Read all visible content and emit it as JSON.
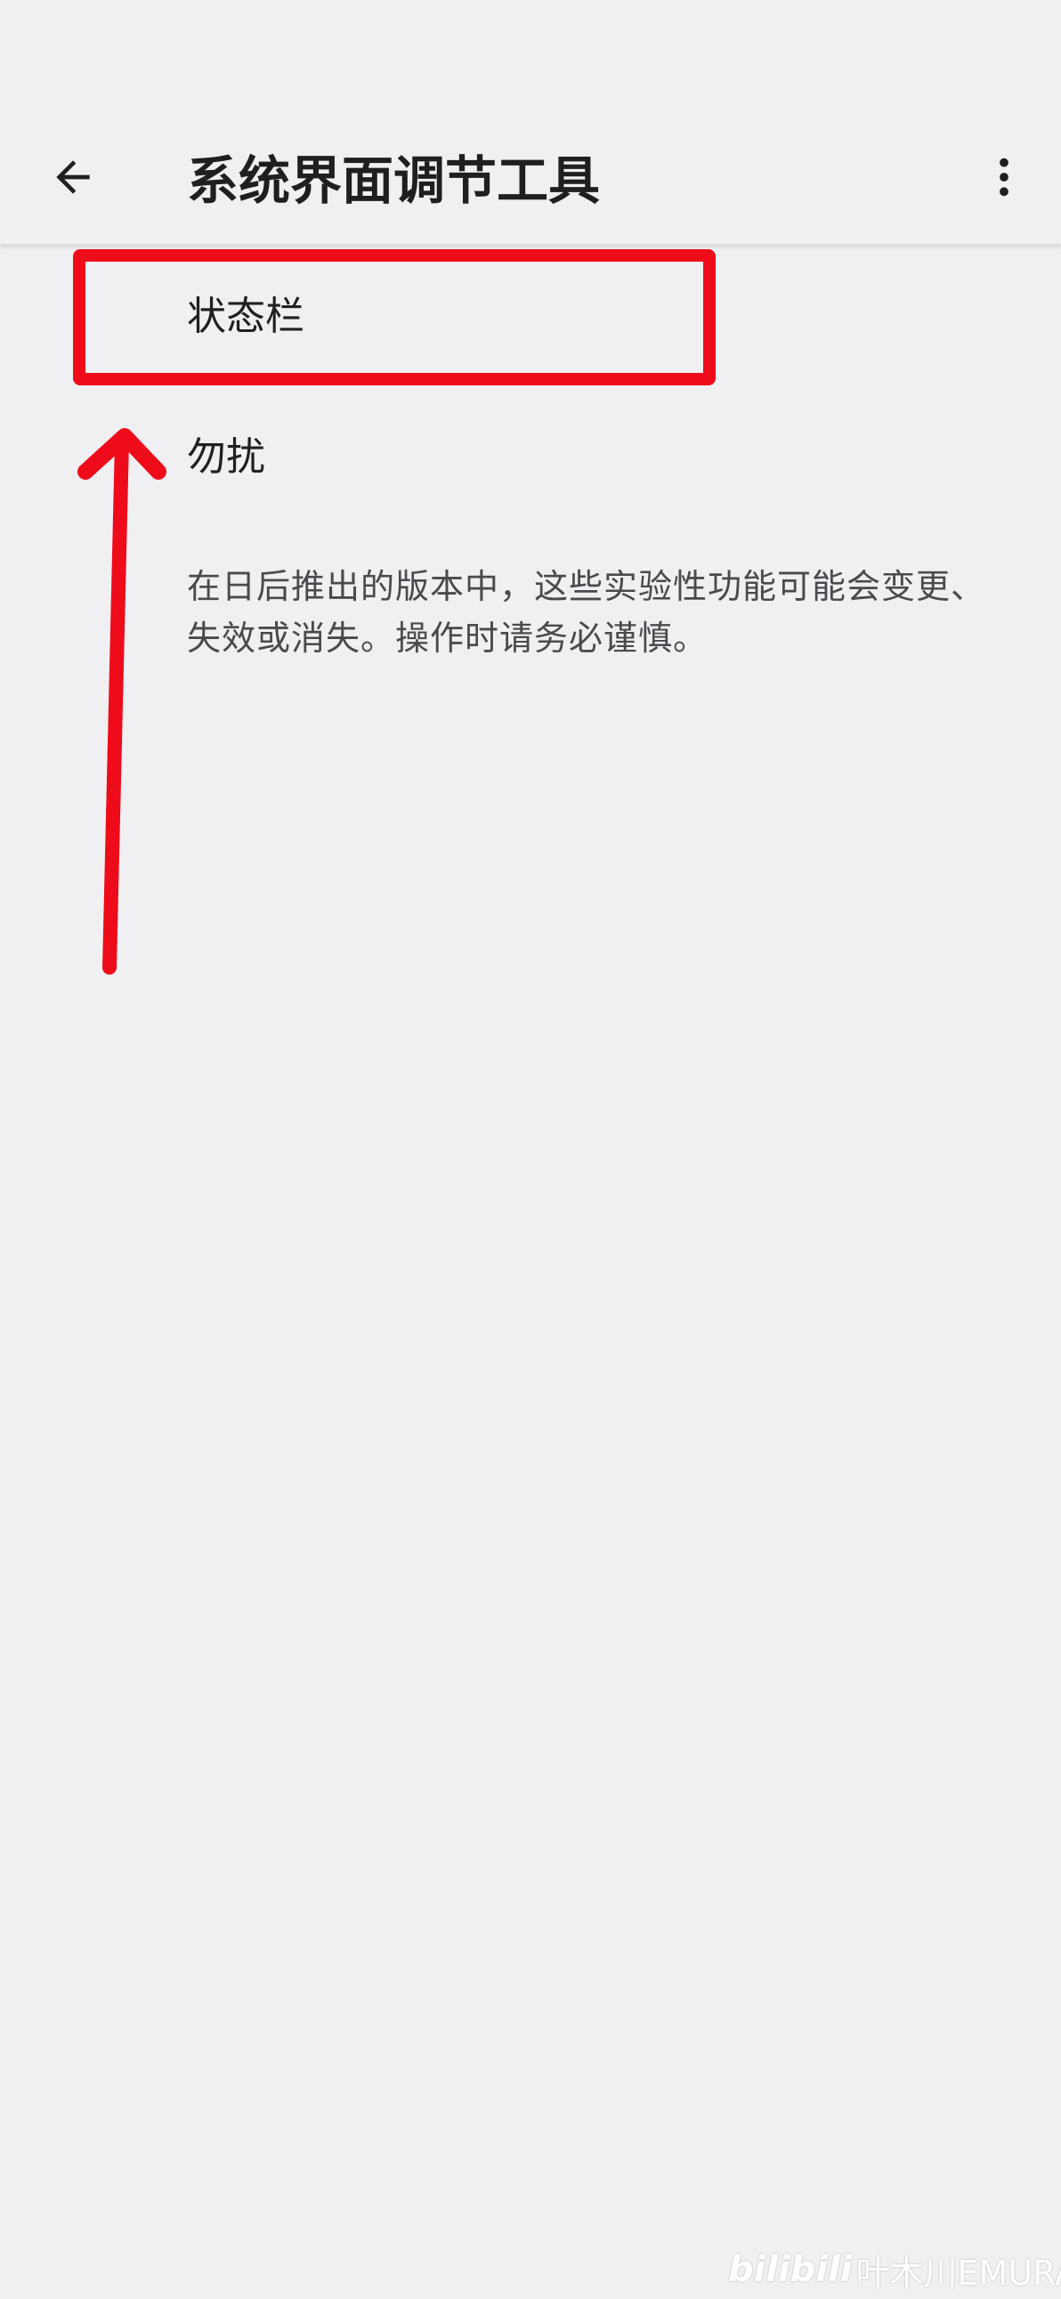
{
  "header": {
    "title": "系统界面调节工具",
    "back_icon": "arrow-left-icon",
    "menu_icon": "more-vert-icon"
  },
  "items": [
    {
      "label": "状态栏"
    },
    {
      "label": "勿扰"
    }
  ],
  "footer_note": "在日后推出的版本中，这些实验性功能可能会变更、失效或消失。操作时请务必谨慎。",
  "annotation": {
    "color": "#ee0b1a"
  },
  "watermark": {
    "logo": "bilibili",
    "author": "叶木川EMURAIN"
  },
  "colors": {
    "background": "#f0f0f3",
    "text_primary": "#1f1f1f",
    "text_secondary": "#4a4a4e"
  }
}
